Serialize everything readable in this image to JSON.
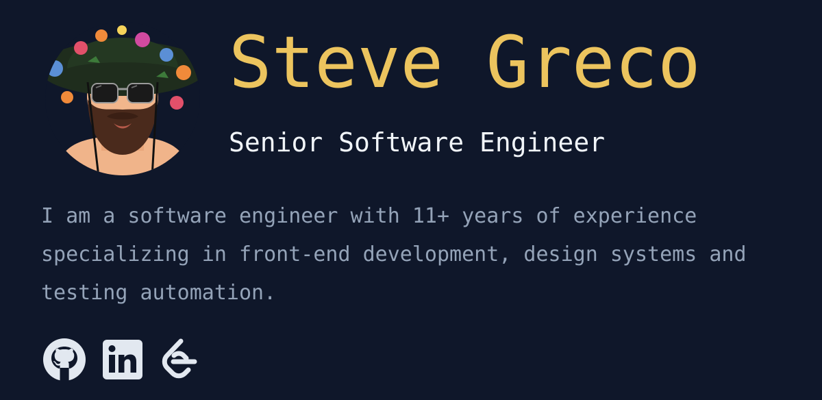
{
  "profile": {
    "name": "Steve Greco",
    "title": "Senior Software Engineer",
    "bio": "I am a software engineer with 11+ years of experience specializing in front-end development, design systems and testing automation."
  },
  "social": [
    {
      "icon": "github-icon"
    },
    {
      "icon": "linkedin-icon"
    },
    {
      "icon": "leetcode-icon"
    }
  ],
  "colors": {
    "background": "#0f172a",
    "name": "#ecc45e",
    "title": "#f1f5f9",
    "bio": "#94a3b8",
    "icons": "#e2e8f0"
  }
}
